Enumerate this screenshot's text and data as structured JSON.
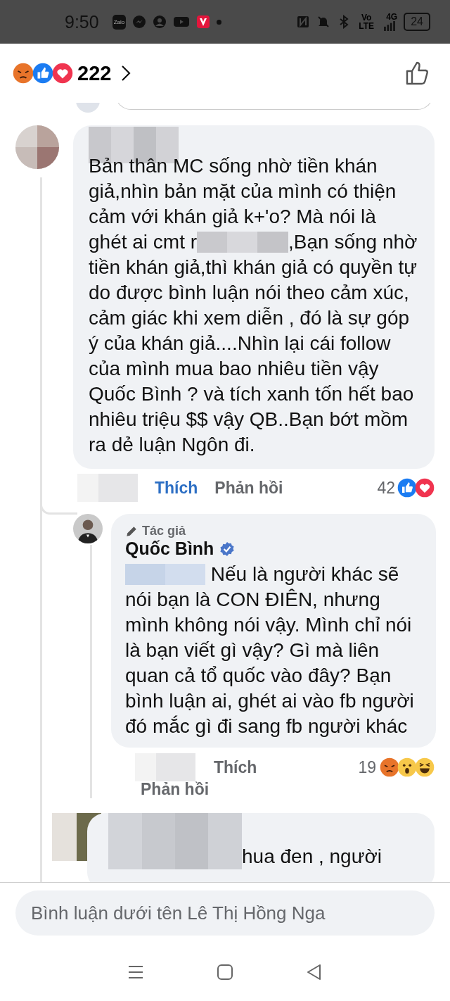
{
  "status_bar": {
    "time": "9:50",
    "app_badge": "Zalo",
    "network": "Vo LTE",
    "cell": "4G",
    "battery": "24"
  },
  "header": {
    "reactions": [
      {
        "kind": "angry"
      },
      {
        "kind": "like"
      },
      {
        "kind": "love"
      }
    ],
    "count": "222"
  },
  "comments": [
    {
      "text_before": "Bản thân MC sống nhờ tiền khán giả,nhìn bản mặt của mình có thiện cảm với khán giả k+'o? Mà nói là ghét ai cmt r",
      "text_after": ",Bạn sống nhờ tiền khán giả,thì khán giả có quyền tự do được bình luận nói theo cảm xúc, cảm giác khi xem diễn , đó là sự góp ý của khán giả....Nhìn lại cái follow của mình mua bao nhiêu tiền vậy Quốc Bình ? và tích xanh tốn hết bao nhiêu triệu $$ vậy QB..Bạn bớt mồm ra dẻ luận Ngôn đi.",
      "like": "Thích",
      "reply": "Phản hồi",
      "liked": true,
      "reaction_count": "42",
      "reactions": [
        {
          "kind": "like"
        },
        {
          "kind": "love"
        }
      ]
    },
    {
      "badge": "Tác giả",
      "author": "Quốc Bình",
      "verified": true,
      "text": "Nếu là người khác sẽ nói bạn là CON ĐIÊN, nhưng mình không nói vậy. Mình chỉ nói là bạn viết gì vậy? Gì mà liên quan cả tổ quốc vào đây? Bạn bình luận ai, ghét ai vào fb người đó mắc gì đi sang fb người khác",
      "like": "Thích",
      "reply": "Phản hồi",
      "liked": false,
      "reaction_count": "19",
      "reactions": [
        {
          "kind": "angry"
        },
        {
          "kind": "wow"
        },
        {
          "kind": "haha"
        }
      ]
    },
    {
      "text": "hua đen , người"
    }
  ],
  "composer": {
    "placeholder": "Bình luận dưới tên Lê Thị Hồng Nga"
  }
}
